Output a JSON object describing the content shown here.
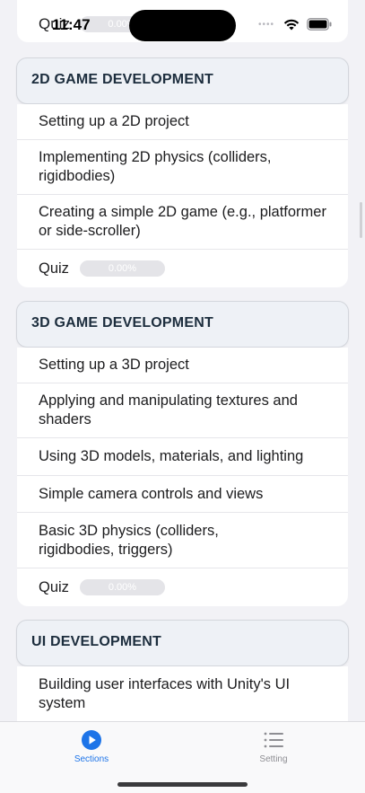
{
  "status_bar": {
    "time": "11:47"
  },
  "top_quiz": {
    "label": "Quiz",
    "progress": "0.00%"
  },
  "sections": [
    {
      "title": "2D GAME DEVELOPMENT",
      "items": [
        {
          "label": "Setting up a 2D project"
        },
        {
          "label": "Implementing 2D physics (colliders, rigidbodies)"
        },
        {
          "label": "Creating a simple 2D game (e.g., platformer or side-scroller)"
        }
      ],
      "quiz": {
        "label": "Quiz",
        "progress": "0.00%"
      }
    },
    {
      "title": "3D GAME DEVELOPMENT",
      "items": [
        {
          "label": "Setting up a 3D project"
        },
        {
          "label": "Applying and manipulating textures and shaders"
        },
        {
          "label": "Using 3D models, materials, and lighting"
        },
        {
          "label": "Simple camera controls and views"
        },
        {
          "label": "Basic 3D physics (colliders, rigidbodies, triggers)"
        }
      ],
      "quiz": {
        "label": "Quiz",
        "progress": "0.00%"
      }
    },
    {
      "title": "UI DEVELOPMENT",
      "items": [
        {
          "label": "Building user interfaces with Unity's UI system"
        }
      ]
    }
  ],
  "tab_bar": {
    "tabs": [
      {
        "label": "Sections",
        "icon": "play-circle-icon",
        "active": true
      },
      {
        "label": "Setting",
        "icon": "list-icon",
        "active": false
      }
    ]
  },
  "colors": {
    "accent": "#1d74e8",
    "header_bg": "#eef1f6",
    "background": "#f2f2f6"
  }
}
